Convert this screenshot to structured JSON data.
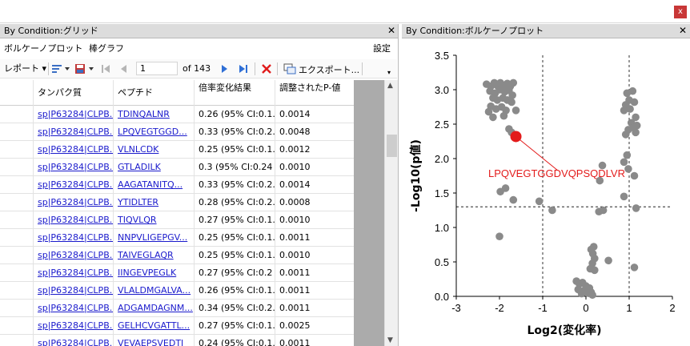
{
  "window": {
    "close_label": "x"
  },
  "left_pane": {
    "title": "By Condition:グリッド",
    "close_label": "✕",
    "tabs": [
      "ボルケーノプロット",
      "棒グラフ"
    ],
    "settings_label": "設定",
    "toolbar": {
      "report_label": "レポート",
      "page_value": "1",
      "page_total": "of 143",
      "export_label": "エクスポート..."
    },
    "columns": [
      "タンパク質",
      "ペプチド",
      "倍率変化結果",
      "調整されたP-値"
    ],
    "rows": [
      [
        "sp|P63284|CLPB...",
        "TDINQALNR",
        "0.26 (95% CI:0.1...",
        "0.0014"
      ],
      [
        "sp|P63284|CLPB...",
        "LPQVEGTGGD...",
        "0.33 (95% CI:0.2...",
        "0.0048"
      ],
      [
        "sp|P63284|CLPB...",
        "VLNLCDK",
        "0.25 (95% CI:0.1...",
        "0.0012"
      ],
      [
        "sp|P63284|CLPB...",
        "GTLADILK",
        "0.3 (95% CI:0.24 ...",
        "0.0010"
      ],
      [
        "sp|P63284|CLPB...",
        "AAGATANITQ...",
        "0.33 (95% CI:0.2...",
        "0.0014"
      ],
      [
        "sp|P63284|CLPB...",
        "YTIDLTER",
        "0.28 (95% CI:0.2...",
        "0.0008"
      ],
      [
        "sp|P63284|CLPB...",
        "TIQVLQR",
        "0.27 (95% CI:0.1...",
        "0.0010"
      ],
      [
        "sp|P63284|CLPB...",
        "NNPVLIGEPGV...",
        "0.25 (95% CI:0.1...",
        "0.0011"
      ],
      [
        "sp|P63284|CLPB...",
        "TAIVEGLAQR",
        "0.25 (95% CI:0.1...",
        "0.0010"
      ],
      [
        "sp|P63284|CLPB...",
        "IINGEVPEGLK",
        "0.27 (95% CI:0.2 ...",
        "0.0011"
      ],
      [
        "sp|P63284|CLPB...",
        "VLALDMGALVA...",
        "0.26 (95% CI:0.1...",
        "0.0011"
      ],
      [
        "sp|P63284|CLPB...",
        "ADGAMDAGNM...",
        "0.34 (95% CI:0.2...",
        "0.0011"
      ],
      [
        "sp|P63284|CLPB...",
        "GELHCVGATTL...",
        "0.27 (95% CI:0.1...",
        "0.0025"
      ],
      [
        "sp|P63284|CLPB...",
        "VEVAEPSVEDTI",
        "0.24 (95% CI:0.1...",
        "0.0011"
      ]
    ]
  },
  "right_pane": {
    "title": "By Condition:ボルケーノプロット",
    "close_label": "✕"
  },
  "chart_data": {
    "type": "scatter",
    "xlabel": "Log2(変化率)",
    "ylabel": "-Log10(p値)",
    "xlim": [
      -3,
      2
    ],
    "ylim": [
      0,
      3.5
    ],
    "xticks": [
      "-3",
      "-2",
      "-1",
      "0",
      "1",
      "2"
    ],
    "yticks": [
      "0.0",
      "0.5",
      "1.0",
      "1.5",
      "2.0",
      "2.5",
      "3.0",
      "3.5"
    ],
    "thresholds": {
      "x": [
        -1,
        1
      ],
      "y": 1.3
    },
    "highlight": {
      "label": "LPQVEGTGGDVQPSQDLVR",
      "x": -1.62,
      "y": 2.32,
      "color": "#e31b1b"
    },
    "point_color": "#8a8a8a",
    "points": [
      [
        -2.3,
        3.08
      ],
      [
        -2.2,
        3.05
      ],
      [
        -2.12,
        3.1
      ],
      [
        -2.05,
        3.06
      ],
      [
        -1.98,
        3.1
      ],
      [
        -1.9,
        3.05
      ],
      [
        -1.82,
        3.09
      ],
      [
        -1.75,
        3.05
      ],
      [
        -1.68,
        3.1
      ],
      [
        -2.22,
        2.98
      ],
      [
        -2.1,
        2.95
      ],
      [
        -2.0,
        3.0
      ],
      [
        -1.88,
        2.97
      ],
      [
        -1.78,
        2.99
      ],
      [
        -1.7,
        2.92
      ],
      [
        -2.15,
        2.88
      ],
      [
        -2.05,
        2.85
      ],
      [
        -1.92,
        2.88
      ],
      [
        -1.82,
        2.85
      ],
      [
        -1.72,
        2.82
      ],
      [
        -2.2,
        2.76
      ],
      [
        -2.08,
        2.72
      ],
      [
        -1.95,
        2.75
      ],
      [
        -1.85,
        2.7
      ],
      [
        -2.25,
        2.68
      ],
      [
        -1.9,
        2.62
      ],
      [
        -1.62,
        2.7
      ],
      [
        -1.78,
        2.43
      ],
      [
        -1.72,
        2.38
      ],
      [
        -2.15,
        2.6
      ],
      [
        -1.86,
        1.57
      ],
      [
        -1.98,
        1.52
      ],
      [
        -1.68,
        1.4
      ],
      [
        -1.08,
        1.38
      ],
      [
        -0.78,
        1.25
      ],
      [
        -2.0,
        0.87
      ],
      [
        0.95,
        2.95
      ],
      [
        1.08,
        2.98
      ],
      [
        1.0,
        2.85
      ],
      [
        0.92,
        2.78
      ],
      [
        1.12,
        2.82
      ],
      [
        0.88,
        2.7
      ],
      [
        1.02,
        2.72
      ],
      [
        1.15,
        2.6
      ],
      [
        1.05,
        2.52
      ],
      [
        1.1,
        2.45
      ],
      [
        0.98,
        2.42
      ],
      [
        1.18,
        2.48
      ],
      [
        0.92,
        2.35
      ],
      [
        1.15,
        2.38
      ],
      [
        0.95,
        2.05
      ],
      [
        0.88,
        1.95
      ],
      [
        0.98,
        1.85
      ],
      [
        0.38,
        1.9
      ],
      [
        1.12,
        1.75
      ],
      [
        0.32,
        1.68
      ],
      [
        0.88,
        1.45
      ],
      [
        0.4,
        1.25
      ],
      [
        0.3,
        1.23
      ],
      [
        1.16,
        1.28
      ],
      [
        0.18,
        0.72
      ],
      [
        0.12,
        0.68
      ],
      [
        0.16,
        0.62
      ],
      [
        0.2,
        0.55
      ],
      [
        0.15,
        0.48
      ],
      [
        0.52,
        0.52
      ],
      [
        0.1,
        0.4
      ],
      [
        0.2,
        0.38
      ],
      [
        1.12,
        0.42
      ],
      [
        -0.22,
        0.22
      ],
      [
        -0.15,
        0.18
      ],
      [
        -0.08,
        0.2
      ],
      [
        0.0,
        0.15
      ],
      [
        0.08,
        0.12
      ],
      [
        -0.18,
        0.1
      ],
      [
        -0.05,
        0.08
      ],
      [
        0.12,
        0.06
      ],
      [
        0.03,
        0.05
      ],
      [
        -0.1,
        0.04
      ],
      [
        0.15,
        0.02
      ]
    ]
  }
}
